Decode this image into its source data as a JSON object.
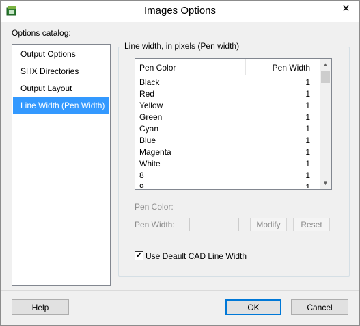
{
  "window": {
    "title": "Images Options",
    "close_glyph": "✕"
  },
  "catalog": {
    "label": "Options catalog:",
    "items": [
      {
        "label": "Output Options",
        "selected": false
      },
      {
        "label": "SHX Directories",
        "selected": false
      },
      {
        "label": "Output Layout",
        "selected": false
      },
      {
        "label": "Line Width (Pen Width)",
        "selected": true
      }
    ]
  },
  "line_width": {
    "group_title": "Line width, in pixels (Pen width)",
    "columns": {
      "pen_color": "Pen Color",
      "pen_width": "Pen Width"
    },
    "rows": [
      {
        "color": "Black",
        "width": "1"
      },
      {
        "color": "Red",
        "width": "1"
      },
      {
        "color": "Yellow",
        "width": "1"
      },
      {
        "color": "Green",
        "width": "1"
      },
      {
        "color": "Cyan",
        "width": "1"
      },
      {
        "color": "Blue",
        "width": "1"
      },
      {
        "color": "Magenta",
        "width": "1"
      },
      {
        "color": "White",
        "width": "1"
      },
      {
        "color": "8",
        "width": "1"
      },
      {
        "color": "9",
        "width": "1"
      }
    ],
    "pen_color_label": "Pen Color:",
    "pen_width_label": "Pen Width:",
    "pen_width_value": "",
    "modify_label": "Modify",
    "reset_label": "Reset",
    "use_default_label": "Use Deault CAD Line Width",
    "use_default_checked": true
  },
  "footer": {
    "help_label": "Help",
    "ok_label": "OK",
    "cancel_label": "Cancel"
  },
  "colors": {
    "selection": "#3399ff",
    "window_bg": "#f0f0f0",
    "default_button_border": "#0078d7"
  }
}
